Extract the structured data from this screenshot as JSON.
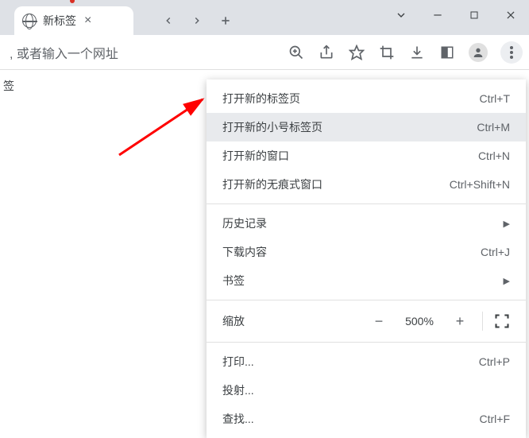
{
  "tab": {
    "title": "新标签"
  },
  "toolbar": {
    "addrHint": ", 或者输入一个网址"
  },
  "page": {
    "sidebarText": "签"
  },
  "menu": {
    "items": [
      {
        "label": "打开新的标签页",
        "shortcut": "Ctrl+T"
      },
      {
        "label": "打开新的小号标签页",
        "shortcut": "Ctrl+M",
        "highlighted": true
      },
      {
        "label": "打开新的窗口",
        "shortcut": "Ctrl+N"
      },
      {
        "label": "打开新的无痕式窗口",
        "shortcut": "Ctrl+Shift+N"
      }
    ],
    "history": "历史记录",
    "downloads": {
      "label": "下载内容",
      "shortcut": "Ctrl+J"
    },
    "bookmarks": "书签",
    "zoom": {
      "label": "缩放",
      "value": "500%"
    },
    "print": {
      "label": "打印...",
      "shortcut": "Ctrl+P"
    },
    "cast": "投射...",
    "find": {
      "label": "查找...",
      "shortcut": "Ctrl+F"
    }
  }
}
